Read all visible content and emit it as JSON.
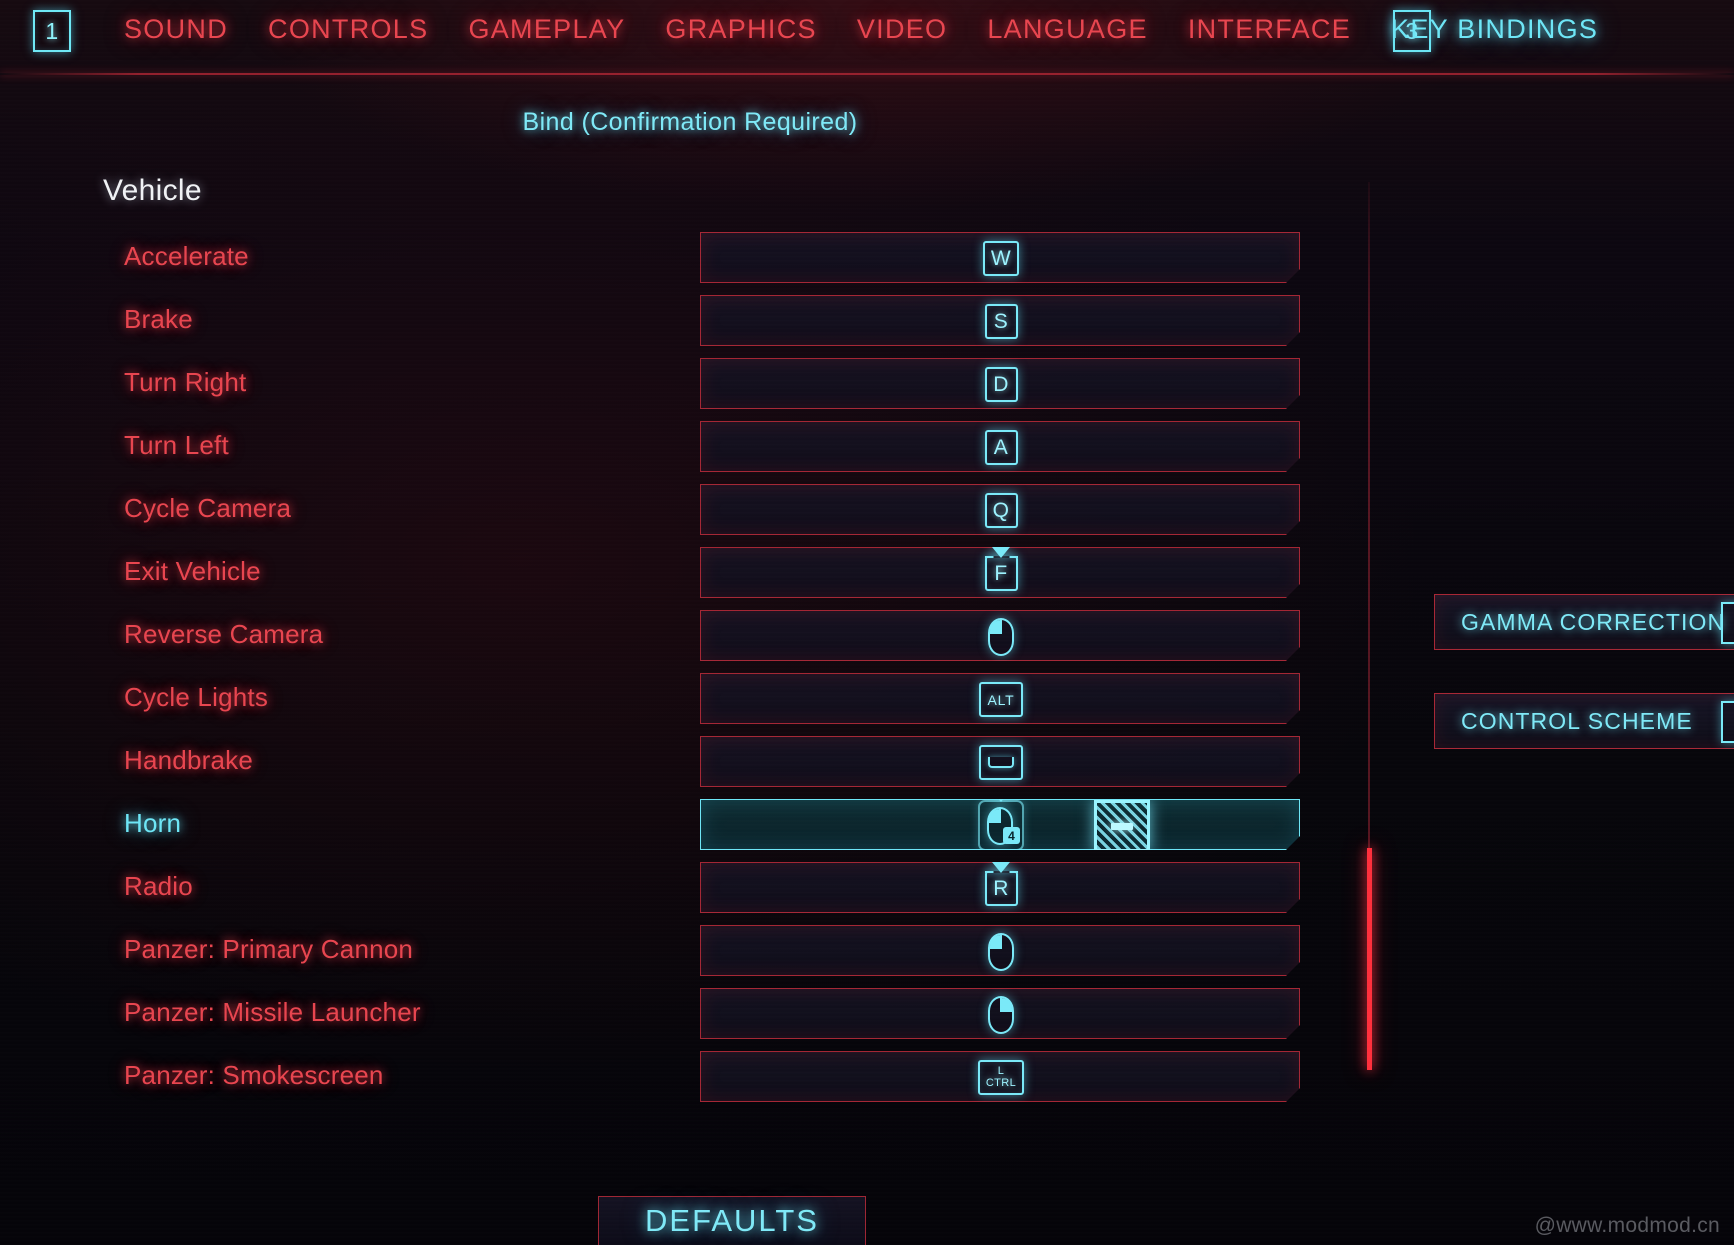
{
  "nav": {
    "badge_left": "1",
    "badge_right": "3",
    "tabs": [
      {
        "label": "SOUND",
        "active": false
      },
      {
        "label": "CONTROLS",
        "active": false
      },
      {
        "label": "GAMEPLAY",
        "active": false
      },
      {
        "label": "GRAPHICS",
        "active": false
      },
      {
        "label": "VIDEO",
        "active": false
      },
      {
        "label": "LANGUAGE",
        "active": false
      },
      {
        "label": "INTERFACE",
        "active": false
      },
      {
        "label": "KEY BINDINGS",
        "active": true
      }
    ]
  },
  "hint": {
    "text": "Bind (Confirmation Required)"
  },
  "section": {
    "title": "Vehicle"
  },
  "bindings": [
    {
      "action": "Accelerate",
      "key": "W",
      "glyph": "keycap",
      "hold": false,
      "selected": false
    },
    {
      "action": "Brake",
      "key": "S",
      "glyph": "keycap",
      "hold": false,
      "selected": false
    },
    {
      "action": "Turn Right",
      "key": "D",
      "glyph": "keycap",
      "hold": false,
      "selected": false
    },
    {
      "action": "Turn Left",
      "key": "A",
      "glyph": "keycap",
      "hold": false,
      "selected": false
    },
    {
      "action": "Cycle Camera",
      "key": "Q",
      "glyph": "keycap",
      "hold": false,
      "selected": false
    },
    {
      "action": "Exit Vehicle",
      "key": "F",
      "glyph": "keycap",
      "hold": true,
      "selected": false
    },
    {
      "action": "Reverse Camera",
      "key": "Mouse Left",
      "glyph": "mouse-left",
      "hold": false,
      "selected": false
    },
    {
      "action": "Cycle Lights",
      "key": "ALT",
      "glyph": "keycap-small",
      "hold": false,
      "selected": false
    },
    {
      "action": "Handbrake",
      "key": "Space",
      "glyph": "spacebar",
      "hold": false,
      "selected": false
    },
    {
      "action": "Horn",
      "key": "Mouse 4",
      "glyph": "mouse-badge",
      "badge": "4",
      "hold": true,
      "selected": true
    },
    {
      "action": "Radio",
      "key": "R",
      "glyph": "keycap",
      "hold": true,
      "selected": false
    },
    {
      "action": "Panzer: Primary Cannon",
      "key": "Mouse Left",
      "glyph": "mouse-left",
      "hold": false,
      "selected": false
    },
    {
      "action": "Panzer: Missile Launcher",
      "key": "Mouse Right",
      "glyph": "mouse-right",
      "hold": false,
      "selected": false
    },
    {
      "action": "Panzer: Smokescreen",
      "key": "L CTRL",
      "glyph": "keycap-stacked",
      "line1": "L",
      "line2": "CTRL",
      "hold": false,
      "selected": false
    }
  ],
  "selected_row": {
    "unbind_label": "—",
    "unbind_name": "clear-binding"
  },
  "side_panel": {
    "buttons": [
      {
        "label": "GAMMA CORRECTION"
      },
      {
        "label": "CONTROL SCHEME"
      }
    ]
  },
  "footer": {
    "defaults_label": "DEFAULTS"
  },
  "watermark": {
    "text": "@www.modmod.cn"
  },
  "colors": {
    "red": "#e8454f",
    "cyan": "#6ee6f6",
    "white": "#f0f2f5",
    "scroll_thumb": "#ff2f3c",
    "background": "#07070c"
  }
}
